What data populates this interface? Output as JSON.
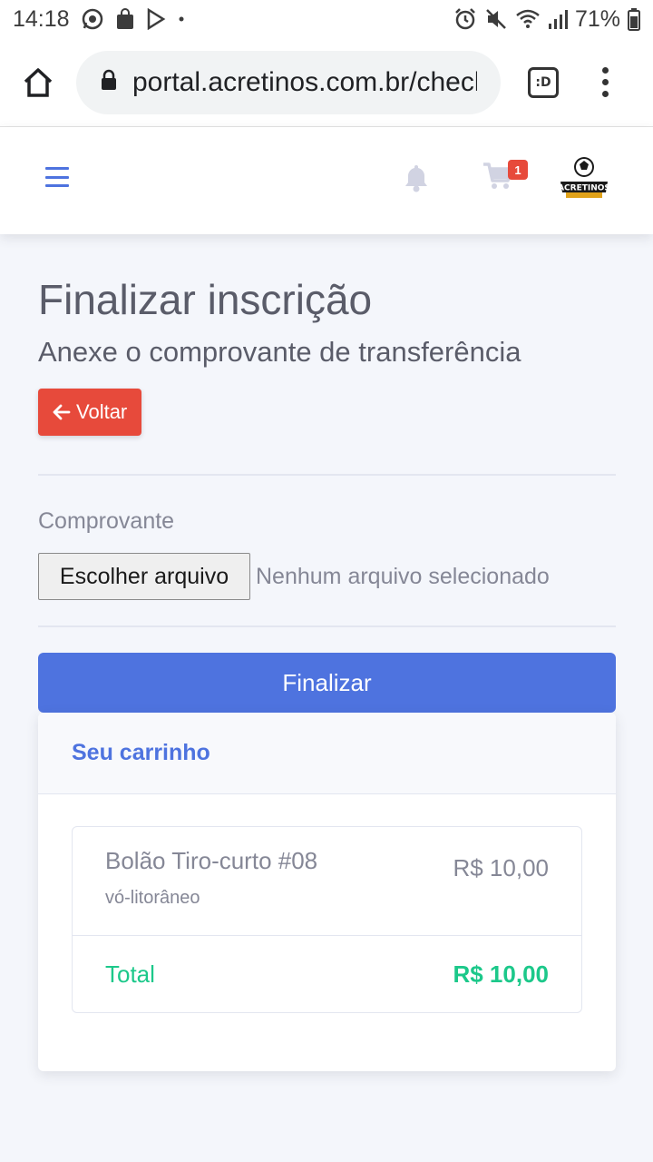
{
  "status_bar": {
    "time": "14:18",
    "battery": "71%"
  },
  "browser": {
    "url": "portal.acretinos.com.br/checkout",
    "tab_icon_label": ":D"
  },
  "navbar": {
    "cart_count": "1",
    "logo_text": "ACRETINOS"
  },
  "page": {
    "title": "Finalizar inscrição",
    "subtitle": "Anexe o comprovante de transferência",
    "back_label": "Voltar"
  },
  "form": {
    "label": "Comprovante",
    "file_button": "Escolher arquivo",
    "file_status": "Nenhum arquivo selecionado",
    "submit_label": "Finalizar"
  },
  "cart": {
    "header": "Seu carrinho",
    "items": [
      {
        "name": "Bolão Tiro-curto #08",
        "subtitle": "vó-litorâneo",
        "price": "R$ 10,00"
      }
    ],
    "total_label": "Total",
    "total_value": "R$ 10,00"
  },
  "colors": {
    "primary": "#4e73df",
    "danger": "#e74a3b",
    "success": "#1cc88a"
  }
}
